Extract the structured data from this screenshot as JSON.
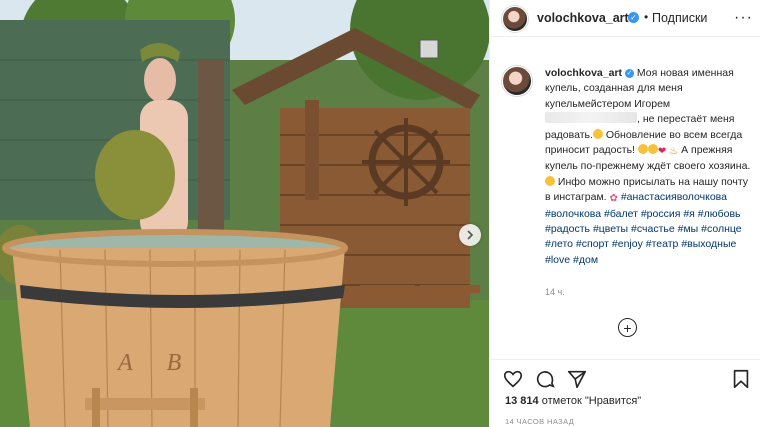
{
  "post": {
    "username": "volochkova_art",
    "header_separator": "•",
    "follow_label": "Подписки",
    "more_label": "···"
  },
  "caption": {
    "username": "volochkova_art",
    "text_part1": "Моя новая именная купель, созданная для меня купельмейстером Игорем",
    "text_part2": ", не перестаёт меня радовать.",
    "text_part3": " Обновление во всем всегда приносит радость! ",
    "text_part4": " А прежняя купель по-прежнему ждёт своего хозяина.",
    "text_part5": " Инфо можно присылать на нашу почту в инстаграм. ",
    "hashtags": [
      "#анастасияволочкова",
      "#волочкова",
      "#балет",
      "#россия",
      "#я",
      "#любовь",
      "#радость",
      "#цветы",
      "#счастье",
      "#мы",
      "#солнце",
      "#лето",
      "#спорт",
      "#enjoy",
      "#театр",
      "#выходные",
      "#love",
      "#дом"
    ]
  },
  "time_short": "14 ч.",
  "add_comment_symbol": "+",
  "likes": {
    "count": "13 814",
    "text": " отметок \"Нравится\""
  },
  "time_ago": "14 ЧАСОВ НАЗАД",
  "icons": {
    "verified": "verified-badge-icon",
    "like": "heart-outline-icon",
    "comment": "speech-bubble-icon",
    "share": "paper-plane-icon",
    "save": "bookmark-icon",
    "next": "chevron-right-icon"
  },
  "tub_monogram": "А В",
  "colors": {
    "accent": "#3897f0",
    "hashtag": "#00376b",
    "muted": "#8e8e8e",
    "text": "#262626"
  }
}
